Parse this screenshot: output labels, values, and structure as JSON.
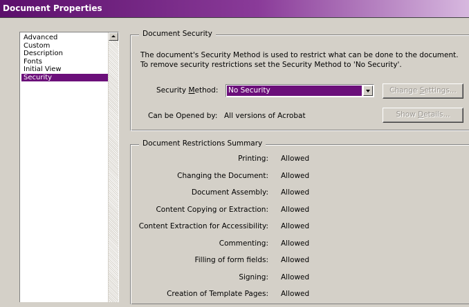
{
  "window": {
    "title": "Document Properties"
  },
  "sidebar": {
    "items": [
      {
        "label": "Advanced",
        "selected": false
      },
      {
        "label": "Custom",
        "selected": false
      },
      {
        "label": "Description",
        "selected": false
      },
      {
        "label": "Fonts",
        "selected": false
      },
      {
        "label": "Initial View",
        "selected": false
      },
      {
        "label": "Security",
        "selected": true
      }
    ]
  },
  "security": {
    "group_title": "Document Security",
    "description": "The document's Security Method is used to restrict what can be done to the document. To remove security restrictions set the Security Method to 'No Security'.",
    "method_label_pre": "Security ",
    "method_label_ul": "M",
    "method_label_post": "ethod:",
    "method_value": "No Security",
    "change_settings_pre": "Change ",
    "change_settings_ul": "S",
    "change_settings_post": "ettings...",
    "opened_by_label": "Can be Opened by:",
    "opened_by_value": "All versions of Acrobat",
    "show_details_pre": "Show ",
    "show_details_ul": "D",
    "show_details_post": "etails..."
  },
  "restrictions": {
    "group_title": "Document Restrictions Summary",
    "rows": [
      {
        "label": "Printing:",
        "value": "Allowed"
      },
      {
        "label": "Changing the Document:",
        "value": "Allowed"
      },
      {
        "label": "Document Assembly:",
        "value": "Allowed"
      },
      {
        "label": "Content Copying or Extraction:",
        "value": "Allowed"
      },
      {
        "label": "Content Extraction for Accessibility:",
        "value": "Allowed"
      },
      {
        "label": "Commenting:",
        "value": "Allowed"
      },
      {
        "label": "Filling of form fields:",
        "value": "Allowed"
      },
      {
        "label": "Signing:",
        "value": "Allowed"
      },
      {
        "label": "Creation of Template Pages:",
        "value": "Allowed"
      }
    ]
  },
  "colors": {
    "accent": "#6b0f7a",
    "dialog_bg": "#d4d0c8"
  }
}
